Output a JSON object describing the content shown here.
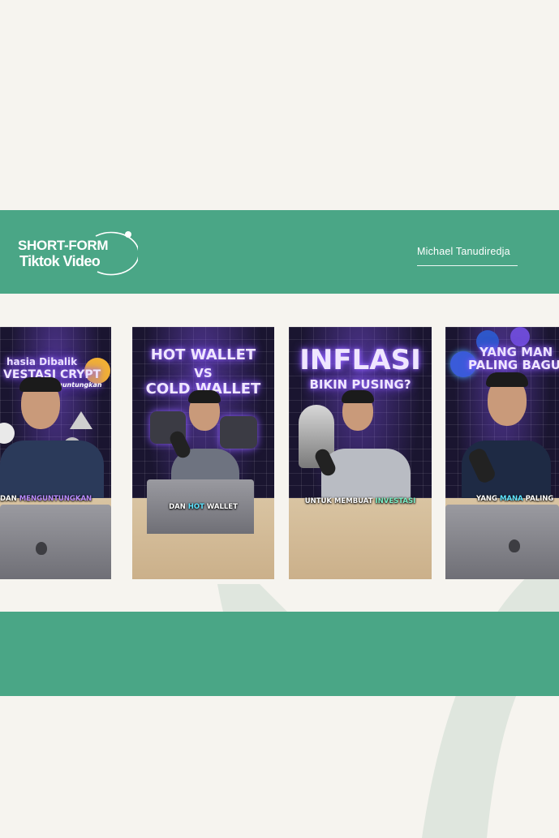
{
  "theme": {
    "green": "#4aa686",
    "background": "#f6f4ef",
    "swoosh": "#dfe6de"
  },
  "header": {
    "logo_line1": "SHORT-FORM",
    "logo_line2": "Tiktok Video",
    "author": "Michael Tanudiredja"
  },
  "cards": [
    {
      "title_line1": "hasia Dibalik",
      "title_line2": "VESTASI CRYPT",
      "title_line3": "enguntungkan",
      "caption_plain": "DAN ",
      "caption_highlight": "MENGUNTUNGKAN",
      "caption_after": ""
    },
    {
      "title_line1": "HOT WALLET",
      "title_line2": "VS",
      "title_line3": "COLD WALLET",
      "caption_plain": "DAN ",
      "caption_highlight": "HOT",
      "caption_after": " WALLET"
    },
    {
      "title_line1": "INFLASI",
      "title_line2": "BIKIN PUSING?",
      "caption_plain": "UNTUK MEMBUAT ",
      "caption_highlight": "INVESTASI",
      "caption_after": ""
    },
    {
      "title_line1": "YANG MAN",
      "title_line2": "PALING BAGUS",
      "caption_plain": "YANG ",
      "caption_highlight": "MANA",
      "caption_after": " PALING"
    }
  ]
}
